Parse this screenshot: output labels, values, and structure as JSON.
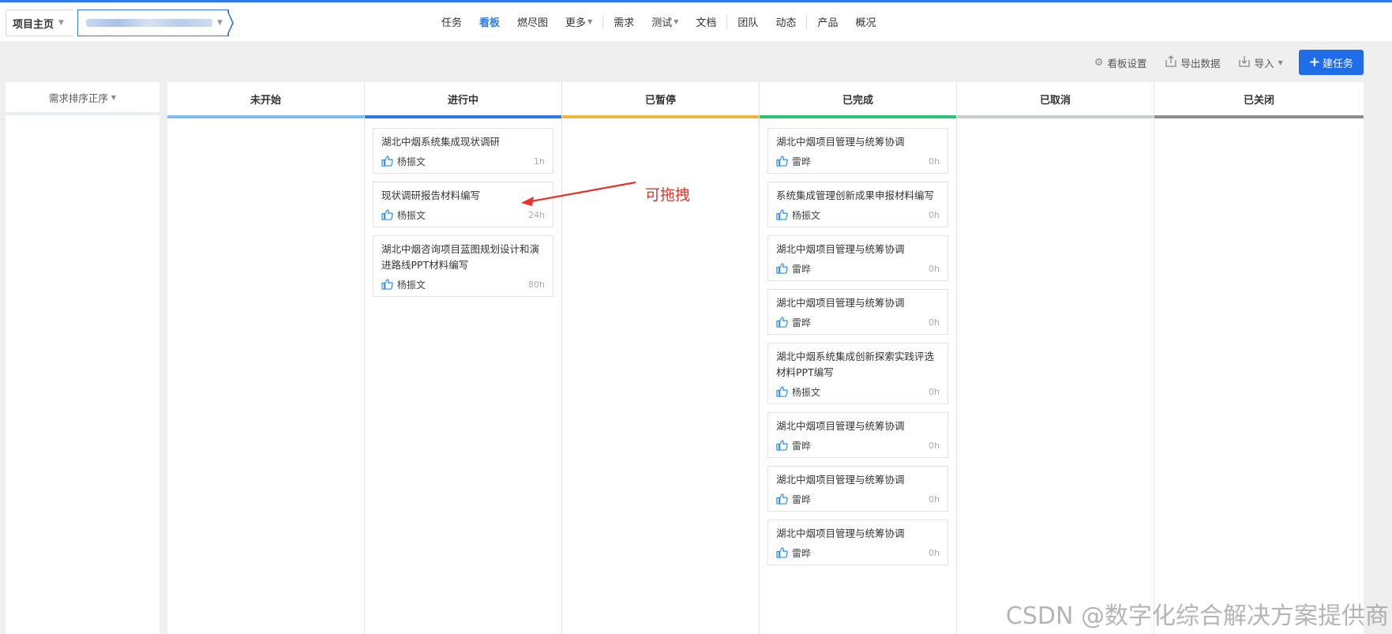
{
  "breadcrumb": {
    "home_label": "项目主页",
    "project_label": ""
  },
  "nav": {
    "items": [
      {
        "label": "任务",
        "active": false
      },
      {
        "label": "看板",
        "active": true
      },
      {
        "label": "燃尽图",
        "active": false
      },
      {
        "label": "更多",
        "active": false
      }
    ],
    "items2": [
      {
        "label": "需求"
      },
      {
        "label": "测试"
      },
      {
        "label": "文档"
      }
    ],
    "items3": [
      {
        "label": "团队"
      },
      {
        "label": "动态"
      }
    ],
    "items4": [
      {
        "label": "产品"
      },
      {
        "label": "概况"
      }
    ]
  },
  "toolbar": {
    "board_settings": "看板设置",
    "export": "导出数据",
    "import": "导入",
    "new_task": "建任务"
  },
  "sort": {
    "label": "需求排序正序"
  },
  "columns": [
    {
      "title": "未开始",
      "color": "#7fbcef",
      "cards": []
    },
    {
      "title": "进行中",
      "color": "#2e7be6",
      "cards": [
        {
          "title": "湖北中烟系统集成现状调研",
          "assignee": "杨振文",
          "hours": "1h"
        },
        {
          "title": "现状调研报告材料编写",
          "assignee": "杨振文",
          "hours": "24h"
        },
        {
          "title": "湖北中烟咨询项目蓝图规划设计和演进路线PPT材料编写",
          "assignee": "杨振文",
          "hours": "80h"
        }
      ]
    },
    {
      "title": "已暂停",
      "color": "#f2b63d",
      "cards": []
    },
    {
      "title": "已完成",
      "color": "#2bc375",
      "cards": [
        {
          "title": "湖北中烟项目管理与统筹协调",
          "assignee": "雷晔",
          "hours": "0h"
        },
        {
          "title": "系统集成管理创新成果申报材料编写",
          "assignee": "杨振文",
          "hours": "0h"
        },
        {
          "title": "湖北中烟项目管理与统筹协调",
          "assignee": "雷晔",
          "hours": "0h"
        },
        {
          "title": "湖北中烟项目管理与统筹协调",
          "assignee": "雷晔",
          "hours": "0h"
        },
        {
          "title": "湖北中烟系统集成创新探索实践评选材料PPT编写",
          "assignee": "杨振文",
          "hours": "0h"
        },
        {
          "title": "湖北中烟项目管理与统筹协调",
          "assignee": "雷晔",
          "hours": "0h"
        },
        {
          "title": "湖北中烟项目管理与统筹协调",
          "assignee": "雷晔",
          "hours": "0h"
        },
        {
          "title": "湖北中烟项目管理与统筹协调",
          "assignee": "雷晔",
          "hours": "0h"
        }
      ]
    },
    {
      "title": "已取消",
      "color": "#c8cdd3",
      "cards": []
    },
    {
      "title": "已关闭",
      "color": "#8a8e96",
      "cards": []
    }
  ],
  "annotation": {
    "text": "可拖拽",
    "color": "#e8322a"
  },
  "watermark": "CSDN @数字化综合解决方案提供商",
  "icons": {
    "thumb": "thumbs-up-icon",
    "gear": "gear-icon",
    "export": "export-icon",
    "import": "import-icon"
  },
  "colors": {
    "accent": "#2e7be6",
    "primary_button": "#1f6ee8"
  }
}
